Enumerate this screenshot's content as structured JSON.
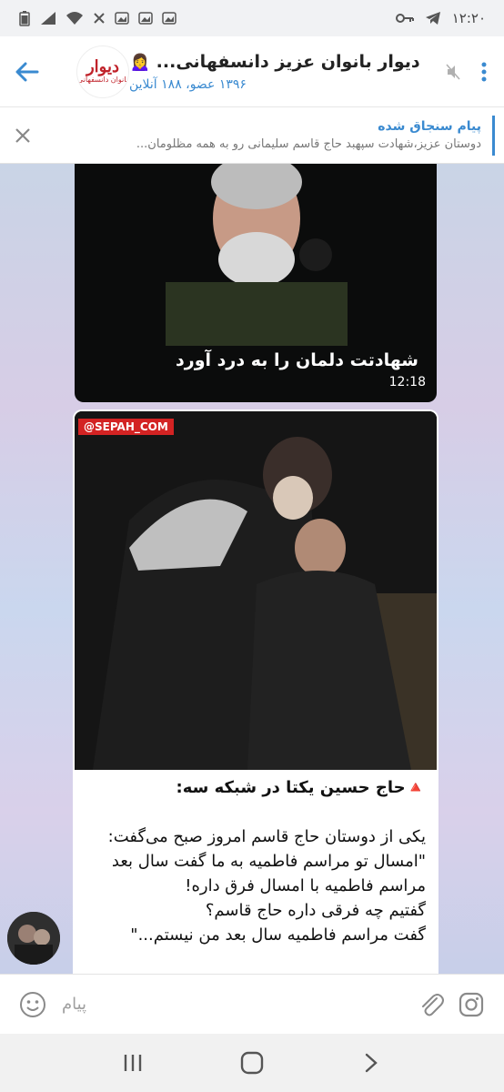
{
  "status_bar": {
    "time": "۱۲:۲۰",
    "left_icons": [
      "battery-icon",
      "signal-icon",
      "wifi-icon",
      "close-icon",
      "gallery-icon",
      "gallery-icon",
      "gallery-icon"
    ],
    "right_icons": [
      "key-icon",
      "telegram-icon"
    ]
  },
  "header": {
    "title": "دیوار بانوان عزیز دانسفهانی...",
    "emoji": "🙍‍♀️",
    "subtitle": "۱۳۹۶ عضو، ۱۸۸ آنلاین",
    "logo_main": "دیوار",
    "logo_sub": "بانوان دانسفهانی"
  },
  "pinned": {
    "label": "پیام سنجاق شده",
    "text": "دوستان عزیز،شهادت سپهبد حاج قاسم سلیمانی رو به همه مظلومان..."
  },
  "messages": {
    "photo1": {
      "caption": "شهادتت دلمان را به درد آورد",
      "time": "12:18"
    },
    "photo2": {
      "watermark": "@SEPAH_COM",
      "headline": "🔺حاج حسین یکتا در شبکه سه:",
      "lines": [
        "یکی از دوستان حاج قاسم امروز صبح می‌گفت:",
        "\"امسال تو مراسم فاطمیه به ما گفت سال بعد",
        "مراسم فاطمیه با امسال فرق داره!",
        "گفتیم چه فرقی داره حاج قاسم؟",
        "گفت مراسم فاطمیه سال بعد من نیستم...\""
      ]
    }
  },
  "input": {
    "placeholder": "پیام"
  },
  "colors": {
    "accent": "#3a8ad0",
    "logo_red": "#c0222a",
    "alert_red": "#d32323"
  }
}
